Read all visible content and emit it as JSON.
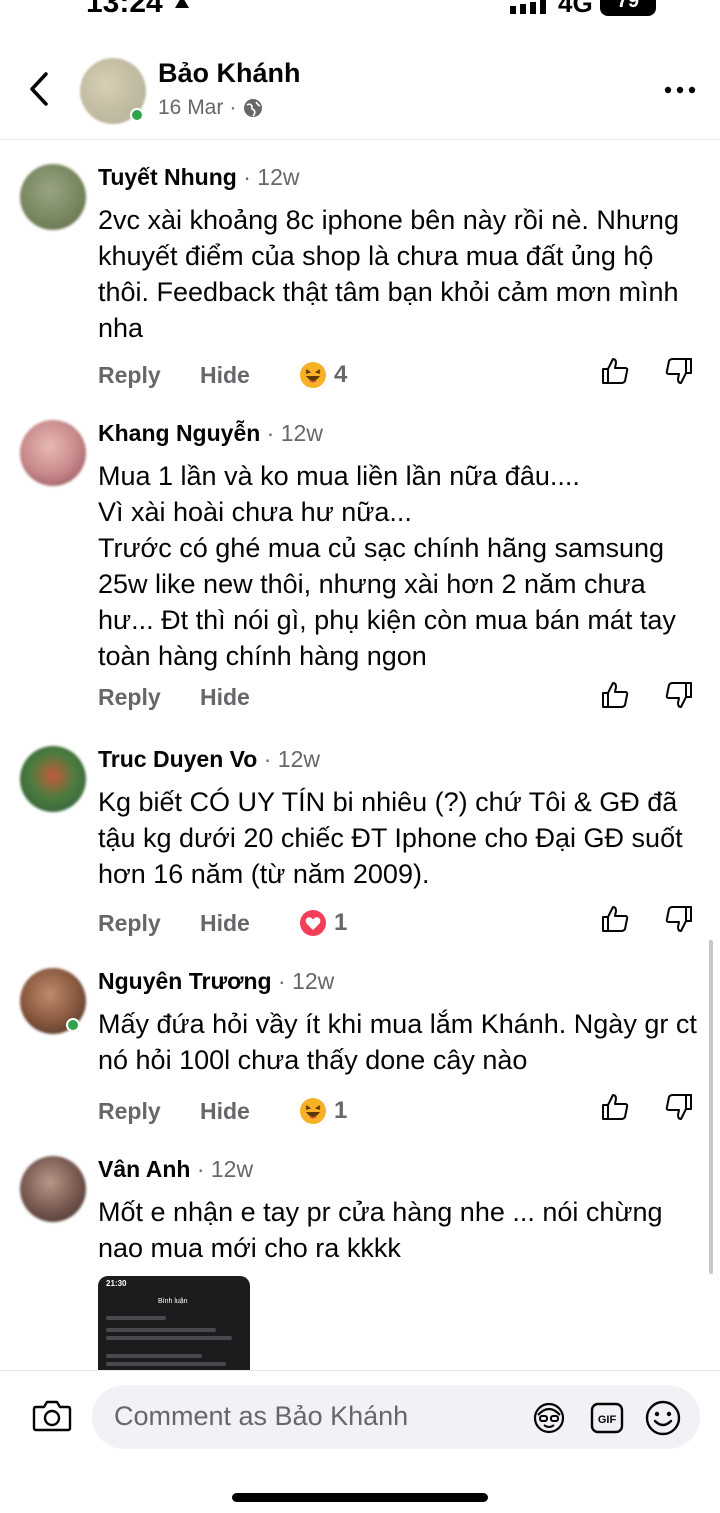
{
  "status_bar": {
    "time": "13:24",
    "network": "4G",
    "battery": "79"
  },
  "header": {
    "name": "Bảo Khánh",
    "date": "16 Mar",
    "separator": "·"
  },
  "comments": [
    {
      "name": "Tuyết Nhung",
      "time": "12w",
      "text": "2vc xài khoảng 8c iphone bên này rồi nè. Nhưng khuyết điểm của shop là chưa mua đất ủng hộ thôi. Feedback thật tâm bạn khỏi cảm mơn mình nha",
      "reply": "Reply",
      "hide": "Hide",
      "reaction_icon": "laughing-emoji-icon",
      "reaction_count": "4"
    },
    {
      "name": "Khang Nguyễn",
      "time": "12w",
      "text": "Mua 1 lần và ko mua liền lần nữa đâu....\nVì xài hoài chưa hư nữa...\nTrước có ghé mua củ sạc chính hãng samsung 25w like new thôi, nhưng xài hơn 2 năm chưa hư... Đt thì nói gì, phụ kiện còn mua bán mát tay toàn hàng chính hàng ngon",
      "reply": "Reply",
      "hide": "Hide"
    },
    {
      "name": "Truc Duyen Vo",
      "time": "12w",
      "text": "Kg biết CÓ UY TÍN bi nhiêu (?) chứ Tôi & GĐ đã tậu kg dưới 20 chiếc ĐT Iphone cho Đại GĐ suốt hơn 16 năm (từ năm 2009).",
      "reply": "Reply",
      "hide": "Hide",
      "reaction_icon": "heart-icon",
      "reaction_count": "1"
    },
    {
      "name": "Nguyên Trương",
      "time": "12w",
      "text": "Mấy đứa hỏi vầy ít khi mua lắm Khánh. Ngày gr ct nó hỏi 100l chưa thấy done cây nào",
      "reply": "Reply",
      "hide": "Hide",
      "reaction_icon": "laughing-emoji-icon",
      "reaction_count": "1"
    },
    {
      "name": "Vân Anh",
      "time": "12w",
      "text": "Mốt e nhận e tay pr cửa hàng nhe ... nói chừng nao mua mới cho ra kkkk"
    }
  ],
  "thumbnail": {
    "time": "21:30",
    "title": "Bình luận"
  },
  "composer": {
    "placeholder": "Comment as Bảo Khánh",
    "gif_label": "GIF"
  },
  "colors": {
    "secondary_text": "#65676b",
    "online": "#31a24c",
    "heart": "#f33e58",
    "emoji": "#f7b125"
  }
}
